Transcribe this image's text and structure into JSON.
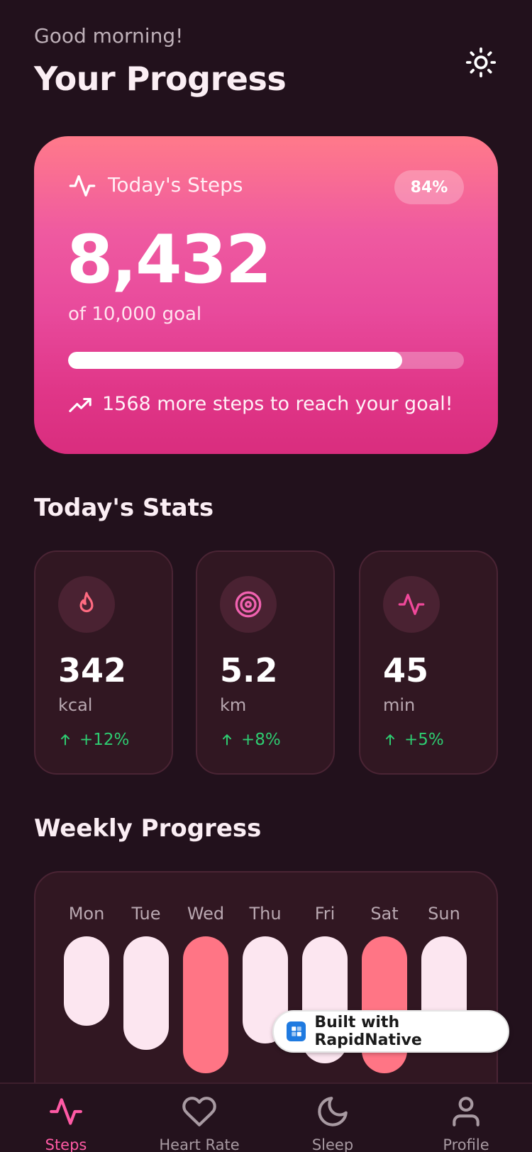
{
  "header": {
    "greeting": "Good morning!",
    "title": "Your Progress",
    "theme_icon": "sun-icon"
  },
  "hero": {
    "icon": "activity-icon",
    "label": "Today's Steps",
    "badge": "84%",
    "value": "8,432",
    "goal_text": "of 10,000 goal",
    "progress_fraction": 0.8432,
    "trend_icon": "trending-up-icon",
    "trend_text": "1568 more steps to reach your goal!"
  },
  "stats": {
    "title": "Today's Stats",
    "items": [
      {
        "icon": "flame-icon",
        "value": "342",
        "unit": "kcal",
        "change": "+12%",
        "color": "#ff6b81"
      },
      {
        "icon": "target-icon",
        "value": "5.2",
        "unit": "km",
        "change": "+8%",
        "color": "#f062b0"
      },
      {
        "icon": "activity-icon",
        "value": "45",
        "unit": "min",
        "change": "+5%",
        "color": "#f0489a"
      }
    ]
  },
  "weekly": {
    "title": "Weekly Progress",
    "days": [
      {
        "label": "Mon",
        "fraction": 0.6,
        "highlight": false
      },
      {
        "label": "Tue",
        "fraction": 0.76,
        "highlight": false
      },
      {
        "label": "Wed",
        "fraction": 0.92,
        "highlight": true
      },
      {
        "label": "Thu",
        "fraction": 0.72,
        "highlight": false
      },
      {
        "label": "Fri",
        "fraction": 0.85,
        "highlight": false
      },
      {
        "label": "Sat",
        "fraction": 0.92,
        "highlight": true
      },
      {
        "label": "Sun",
        "fraction": 0.68,
        "highlight": false
      }
    ]
  },
  "built_badge": {
    "text": "Built with RapidNative"
  },
  "nav": {
    "items": [
      {
        "label": "Steps",
        "icon": "activity-icon",
        "active": true
      },
      {
        "label": "Heart Rate",
        "icon": "heart-icon",
        "active": false
      },
      {
        "label": "Sleep",
        "icon": "moon-icon",
        "active": false
      },
      {
        "label": "Profile",
        "icon": "user-icon",
        "active": false
      }
    ]
  },
  "colors": {
    "background": "#22111c",
    "accent": "#ff5aa5",
    "bar_light": "#fce6f0",
    "bar_highlight": "#ff7585",
    "positive": "#2ecc71"
  }
}
